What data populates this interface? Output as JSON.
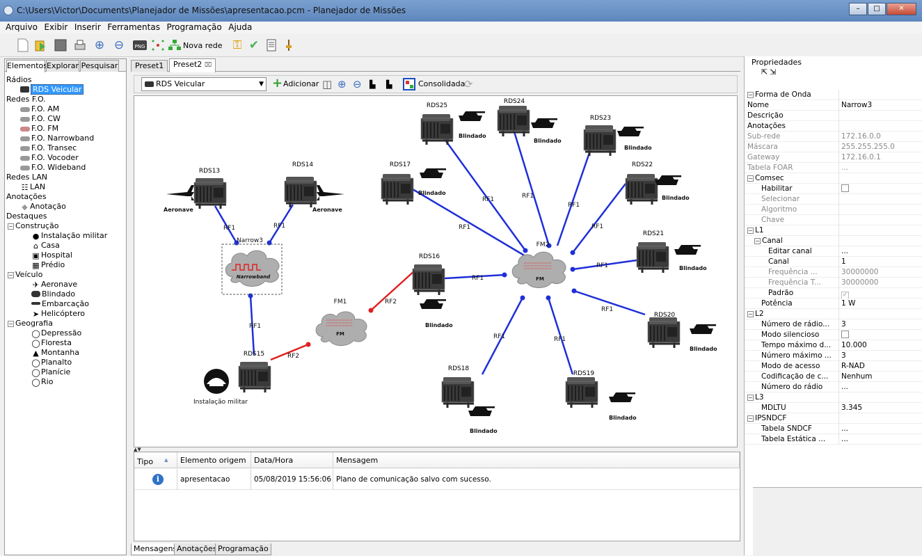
{
  "window": {
    "title": "C:\\Users\\Victor\\Documents\\Planejador de Missões\\apresentacao.pcm - Planejador de Missões"
  },
  "menu": [
    "Arquivo",
    "Exibir",
    "Inserir",
    "Ferramentas",
    "Programação",
    "Ajuda"
  ],
  "toolbar": {
    "nova_rede": "Nova rede"
  },
  "left_tabs": [
    "Elementos",
    "Explorar",
    "Pesquisar"
  ],
  "tree": {
    "radios": "Rádios",
    "rds_veicular": "RDS Veicular",
    "redes_fo": "Redes F.O.",
    "fo_items": [
      "F.O. AM",
      "F.O. CW",
      "F.O. FM",
      "F.O. Narrowband",
      "F.O. Transec",
      "F.O. Vocoder",
      "F.O. Wideband"
    ],
    "redes_lan": "Redes LAN",
    "lan": "LAN",
    "anotacoes": "Anotações",
    "anotacao": "Anotação",
    "destaques": "Destaques",
    "construcao": "Construção",
    "construcao_items": [
      "Instalação militar",
      "Casa",
      "Hospital",
      "Prédio"
    ],
    "veiculo": "Veículo",
    "veiculo_items": [
      "Aeronave",
      "Blindado",
      "Embarcação",
      "Helicóptero"
    ],
    "geografia": "Geografia",
    "geografia_items": [
      "Depressão",
      "Floresta",
      "Montanha",
      "Planalto",
      "Planície",
      "Rio"
    ]
  },
  "editor_tabs": [
    "Preset1",
    "Preset2"
  ],
  "editor_toolbar": {
    "combo": "RDS Veicular",
    "adicionar": "Adicionar",
    "consolidada": "Consolidada"
  },
  "diagram": {
    "radios": [
      "RDS13",
      "RDS14",
      "RDS15",
      "RDS16",
      "RDS17",
      "RDS18",
      "RDS19",
      "RDS20",
      "RDS21",
      "RDS22",
      "RDS23",
      "RDS24",
      "RDS25"
    ],
    "networks": {
      "narrow": "Narrow3",
      "narrow_label": "Narrowband",
      "fm1": "FM1",
      "fm2": "FM2",
      "fm_label": "FM"
    },
    "links": {
      "rf1": "RF1",
      "rf2": "RF2"
    },
    "tags": {
      "aeronave": "Aeronave",
      "blindado": "Blindado",
      "instalacao": "Instalação militar"
    }
  },
  "messages": {
    "columns": [
      "Tipo",
      "Elemento origem",
      "Data/Hora",
      "Mensagem"
    ],
    "row": {
      "origem": "apresentacao",
      "data": "05/08/2019 15:56:06",
      "mensagem": "Plano de comunicação salvo com sucesso."
    }
  },
  "bottom_tabs": [
    "Mensagens",
    "Anotações",
    "Programação"
  ],
  "properties": {
    "title": "Propriedades",
    "rows": [
      {
        "n": "Forma de Onda",
        "v": "",
        "t": "cat",
        "i": 0
      },
      {
        "n": "Nome",
        "v": "Narrow3",
        "t": "",
        "i": 0
      },
      {
        "n": "Descrição",
        "v": "",
        "t": "",
        "i": 0
      },
      {
        "n": "Anotações",
        "v": "",
        "t": "",
        "i": 0
      },
      {
        "n": "Sub-rede",
        "v": "172.16.0.0",
        "t": "dis",
        "i": 0
      },
      {
        "n": "Máscara",
        "v": "255.255.255.0",
        "t": "dis",
        "i": 0
      },
      {
        "n": "Gateway",
        "v": "172.16.0.1",
        "t": "dis",
        "i": 0
      },
      {
        "n": "Tabela FOAR",
        "v": "...",
        "t": "dis",
        "i": 0
      },
      {
        "n": "Comsec",
        "v": "",
        "t": "cat",
        "i": 0
      },
      {
        "n": "Habilitar",
        "v": "",
        "t": "check",
        "i": 2
      },
      {
        "n": "Selecionar",
        "v": "",
        "t": "dis",
        "i": 2
      },
      {
        "n": "Algoritmo",
        "v": "",
        "t": "dis",
        "i": 2
      },
      {
        "n": "Chave",
        "v": "",
        "t": "dis",
        "i": 2
      },
      {
        "n": "L1",
        "v": "",
        "t": "cat",
        "i": 0
      },
      {
        "n": "Canal",
        "v": "",
        "t": "cat",
        "i": 1
      },
      {
        "n": "Editar canal",
        "v": "...",
        "t": "",
        "i": 3
      },
      {
        "n": "Canal",
        "v": "1",
        "t": "",
        "i": 3
      },
      {
        "n": "Frequência ...",
        "v": "30000000",
        "t": "dis",
        "i": 3
      },
      {
        "n": "Frequência T...",
        "v": "30000000",
        "t": "dis",
        "i": 3
      },
      {
        "n": "Padrão",
        "v": "",
        "t": "checkdis",
        "i": 3
      },
      {
        "n": "Potência",
        "v": "1 W",
        "t": "",
        "i": 2
      },
      {
        "n": "L2",
        "v": "",
        "t": "cat",
        "i": 0
      },
      {
        "n": "Número de rádio...",
        "v": "3",
        "t": "",
        "i": 2
      },
      {
        "n": "Modo silencioso",
        "v": "",
        "t": "check",
        "i": 2
      },
      {
        "n": "Tempo máximo d...",
        "v": "10.000",
        "t": "",
        "i": 2
      },
      {
        "n": "Número máximo ...",
        "v": "3",
        "t": "",
        "i": 2
      },
      {
        "n": "Modo de acesso",
        "v": "R-NAD",
        "t": "",
        "i": 2
      },
      {
        "n": "Codificação de c...",
        "v": "Nenhum",
        "t": "",
        "i": 2
      },
      {
        "n": "Número do rádio",
        "v": "...",
        "t": "",
        "i": 2
      },
      {
        "n": "L3",
        "v": "",
        "t": "cat",
        "i": 0
      },
      {
        "n": "MDLTU",
        "v": "3.345",
        "t": "",
        "i": 2
      },
      {
        "n": "IPSNDCF",
        "v": "",
        "t": "cat",
        "i": 0
      },
      {
        "n": "Tabela SNDCF",
        "v": "...",
        "t": "",
        "i": 2
      },
      {
        "n": "Tabela Estática ...",
        "v": "...",
        "t": "",
        "i": 2
      }
    ]
  },
  "colors": {
    "link_rf1": "#1f2fd8",
    "link_rf2": "#e02020",
    "selection": "#3399ff"
  }
}
